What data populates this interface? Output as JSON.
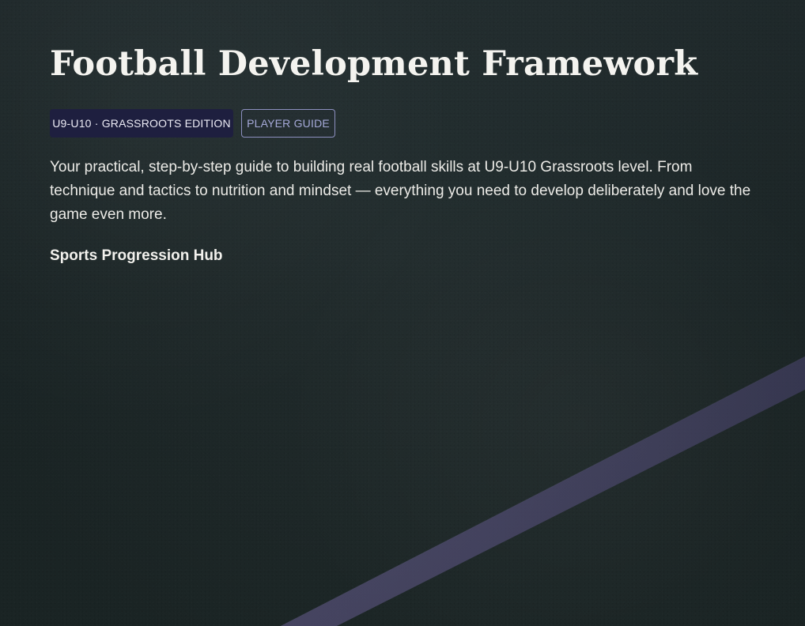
{
  "hero": {
    "title": "Football Development Framework",
    "badges": [
      {
        "label": "U9-U10 · GRASSROOTS EDITION",
        "color": "#1e1f3f"
      },
      {
        "label": "PLAYER GUIDE",
        "color": "#8d90c0"
      }
    ],
    "description": "Your practical, step-by-step guide to building real football skills at U9-U10 Grassroots level. From technique and tactics to nutrition and mindset — everything you need to develop deliberately and love the game even more.",
    "hub_name": "Sports Progression Hub"
  },
  "theme": {
    "background": "#1f2a2b",
    "line": "#5f5a84",
    "text": "#f4f3ef"
  }
}
